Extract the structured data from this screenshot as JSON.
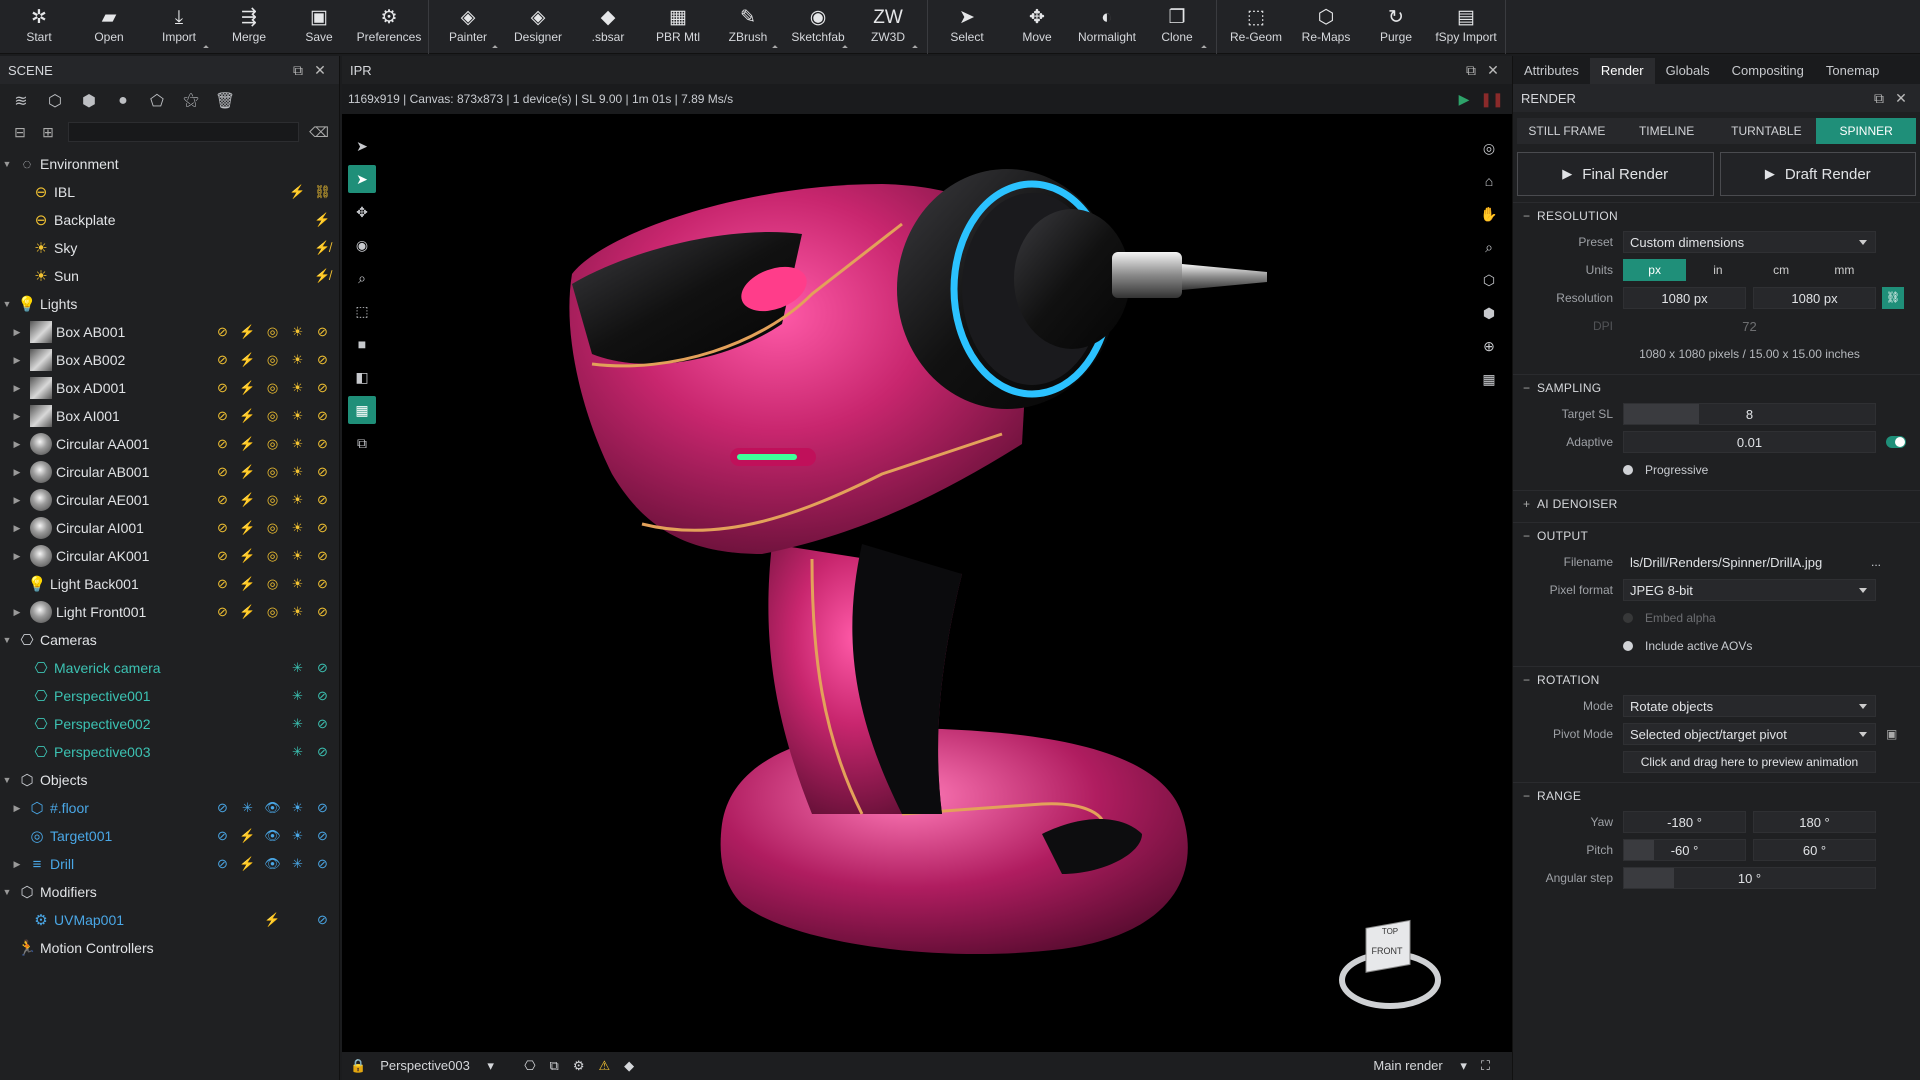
{
  "toolbar": {
    "groups": [
      [
        {
          "label": "Start",
          "icon": "✲",
          "dd": false
        },
        {
          "label": "Open",
          "icon": "▰",
          "dd": false
        },
        {
          "label": "Import",
          "icon": "⤓",
          "dd": true
        },
        {
          "label": "Merge",
          "icon": "⇶",
          "dd": false
        },
        {
          "label": "Save",
          "icon": "▣",
          "dd": false
        },
        {
          "label": "Preferences",
          "icon": "⚙",
          "dd": false
        }
      ],
      [
        {
          "label": "Painter",
          "icon": "◈",
          "dd": true
        },
        {
          "label": "Designer",
          "icon": "◈",
          "dd": false
        },
        {
          "label": ".sbsar",
          "icon": "◆",
          "dd": false
        },
        {
          "label": "PBR Mtl",
          "icon": "▦",
          "dd": false
        },
        {
          "label": "ZBrush",
          "icon": "✎",
          "dd": true
        },
        {
          "label": "Sketchfab",
          "icon": "◉",
          "dd": true
        },
        {
          "label": "ZW3D",
          "icon": "ZW",
          "dd": true
        }
      ],
      [
        {
          "label": "Select",
          "icon": "➤",
          "dd": false
        },
        {
          "label": "Move",
          "icon": "✥",
          "dd": false
        },
        {
          "label": "Normalight",
          "icon": "◐",
          "dd": false
        },
        {
          "label": "Clone",
          "icon": "❐",
          "dd": true
        }
      ],
      [
        {
          "label": "Re-Geom",
          "icon": "⬚",
          "dd": false
        },
        {
          "label": "Re-Maps",
          "icon": "⬡",
          "dd": false
        },
        {
          "label": "Purge",
          "icon": "↻",
          "dd": false
        },
        {
          "label": "fSpy Import",
          "icon": "▤",
          "dd": false
        }
      ]
    ]
  },
  "scene": {
    "title": "SCENE",
    "search_placeholder": "",
    "environment": {
      "label": "Environment",
      "items": [
        {
          "label": "IBL",
          "icon": "⊖"
        },
        {
          "label": "Backplate",
          "icon": "⊖"
        },
        {
          "label": "Sky",
          "icon": "☀"
        },
        {
          "label": "Sun",
          "icon": "☀"
        }
      ]
    },
    "lights": {
      "label": "Lights",
      "items": [
        {
          "label": "Box AB001",
          "kind": "sq"
        },
        {
          "label": "Box AB002",
          "kind": "sq"
        },
        {
          "label": "Box AD001",
          "kind": "sq"
        },
        {
          "label": "Box AI001",
          "kind": "sq"
        },
        {
          "label": "Circular AA001",
          "kind": "ball"
        },
        {
          "label": "Circular AB001",
          "kind": "ball"
        },
        {
          "label": "Circular AE001",
          "kind": "ball"
        },
        {
          "label": "Circular AI001",
          "kind": "ball"
        },
        {
          "label": "Circular AK001",
          "kind": "ball"
        },
        {
          "label": "Light Back001",
          "kind": "bulb"
        },
        {
          "label": "Light Front001",
          "kind": "ball"
        }
      ]
    },
    "cameras": {
      "label": "Cameras",
      "items": [
        {
          "label": "Maverick camera"
        },
        {
          "label": "Perspective001"
        },
        {
          "label": "Perspective002"
        },
        {
          "label": "Perspective003"
        }
      ]
    },
    "objects": {
      "label": "Objects",
      "items": [
        {
          "label": "#.floor"
        },
        {
          "label": "Target001"
        },
        {
          "label": "Drill"
        }
      ]
    },
    "modifiers": {
      "label": "Modifiers",
      "items": [
        {
          "label": "UVMap001"
        }
      ]
    },
    "motion": {
      "label": "Motion Controllers"
    }
  },
  "ipr": {
    "title": "IPR",
    "info": "1169x919  |  Canvas: 873x873  |  1 device(s)  |  SL 9.00  |  1m 01s  |  7.89 Ms/s",
    "camera": "Perspective003",
    "output": "Main render",
    "cube_top": "TOP",
    "cube_front": "FRONT"
  },
  "props": {
    "tabs": [
      "Attributes",
      "Render",
      "Globals",
      "Compositing",
      "Tonemap"
    ],
    "active_tab": "Render",
    "title": "RENDER",
    "render_tabs": [
      "STILL FRAME",
      "TIMELINE",
      "TURNTABLE",
      "SPINNER"
    ],
    "active_render_tab": "SPINNER",
    "final_render": "Final Render",
    "draft_render": "Draft Render",
    "resolution": {
      "title": "RESOLUTION",
      "preset_label": "Preset",
      "preset": "Custom dimensions",
      "units_label": "Units",
      "units": [
        "px",
        "in",
        "cm",
        "mm"
      ],
      "active_unit": "px",
      "res_label": "Resolution",
      "width": "1080 px",
      "height": "1080 px",
      "dpi_label": "DPI",
      "dpi": "72",
      "summary": "1080 x 1080 pixels  /  15.00 x 15.00 inches"
    },
    "sampling": {
      "title": "SAMPLING",
      "target_label": "Target SL",
      "target": "8",
      "adaptive_label": "Adaptive",
      "adaptive": "0.01",
      "progressive": "Progressive"
    },
    "ai_denoiser": {
      "title": "AI DENOISER"
    },
    "output": {
      "title": "OUTPUT",
      "filename_label": "Filename",
      "filename": "ls/Drill/Renders/Spinner/DrillA.jpg",
      "more": "...",
      "format_label": "Pixel format",
      "format": "JPEG 8-bit",
      "embed_alpha": "Embed alpha",
      "include_aovs": "Include active AOVs"
    },
    "rotation": {
      "title": "ROTATION",
      "mode_label": "Mode",
      "mode": "Rotate objects",
      "pivot_label": "Pivot Mode",
      "pivot": "Selected object/target pivot",
      "preview": "Click and drag here to preview animation"
    },
    "range": {
      "title": "RANGE",
      "yaw_label": "Yaw",
      "yaw_min": "-180 °",
      "yaw_max": "180 °",
      "pitch_label": "Pitch",
      "pitch_min": "-60 °",
      "pitch_max": "60 °",
      "step_label": "Angular step",
      "step": "10 °"
    }
  },
  "colors": {
    "accent": "#1f8f79",
    "light_icon": "#f2c232",
    "camera_text": "#3cc2b3",
    "object_text": "#4aa7e6",
    "drill_body": "#c8266e"
  }
}
